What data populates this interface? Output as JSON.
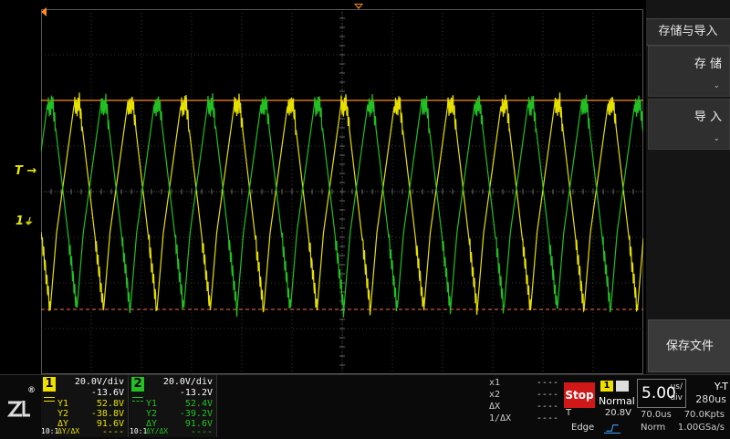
{
  "panel": {
    "title": "存储与导入",
    "btn_store": "存 储",
    "btn_import": "导 入",
    "btn_save_file": "保存文件",
    "chevron": "⌄"
  },
  "markers": {
    "trigger": "T",
    "channel": "1"
  },
  "logo": {
    "text": "ZLG",
    "reg": "®"
  },
  "ch1": {
    "num": "1",
    "vdiv": "20.0V/div",
    "offset": "-13.6V",
    "y1_label": "Y1",
    "y1": "52.8V",
    "y2_label": "Y2",
    "y2": "-38.8V",
    "dy_label": "ΔY",
    "dy": "91.6V",
    "probe": "10:1",
    "dydx_label": "ΔY/ΔX",
    "dydx": "----"
  },
  "ch2": {
    "num": "2",
    "vdiv": "20.0V/div",
    "offset": "-13.2V",
    "y1_label": "Y1",
    "y1": "52.4V",
    "y2_label": "Y2",
    "y2": "-39.2V",
    "dy_label": "ΔY",
    "dy": "91.6V",
    "probe": "10:1",
    "dydx_label": "ΔY/ΔX",
    "dydx": "----"
  },
  "cursors": {
    "x1_label": "x1",
    "x1": "----",
    "x2_label": "x2",
    "x2": "----",
    "dx_label": "ΔX",
    "dx": "----",
    "inv_label": "1/ΔX",
    "inv": "----"
  },
  "acquisition": {
    "stop": "Stop",
    "trig_source": "1",
    "trig_mode": "Normal",
    "trig_label": "T",
    "trig_level": "20.8V",
    "trig_type": "Edge"
  },
  "timebase": {
    "value": "5.00",
    "unit_top": "us/",
    "unit_bot": "div",
    "mode": "Y-T",
    "delay": "280us",
    "pos": "70.0us",
    "mem": "70.0Kpts",
    "acq": "Norm",
    "rate": "1.00GSa/s"
  },
  "colors": {
    "ch1": "#e8e000",
    "ch2": "#22c022",
    "cursor_solid": "#ff8a1a",
    "cursor_dashed": "#ff6a4a",
    "stop": "#d01818"
  }
}
